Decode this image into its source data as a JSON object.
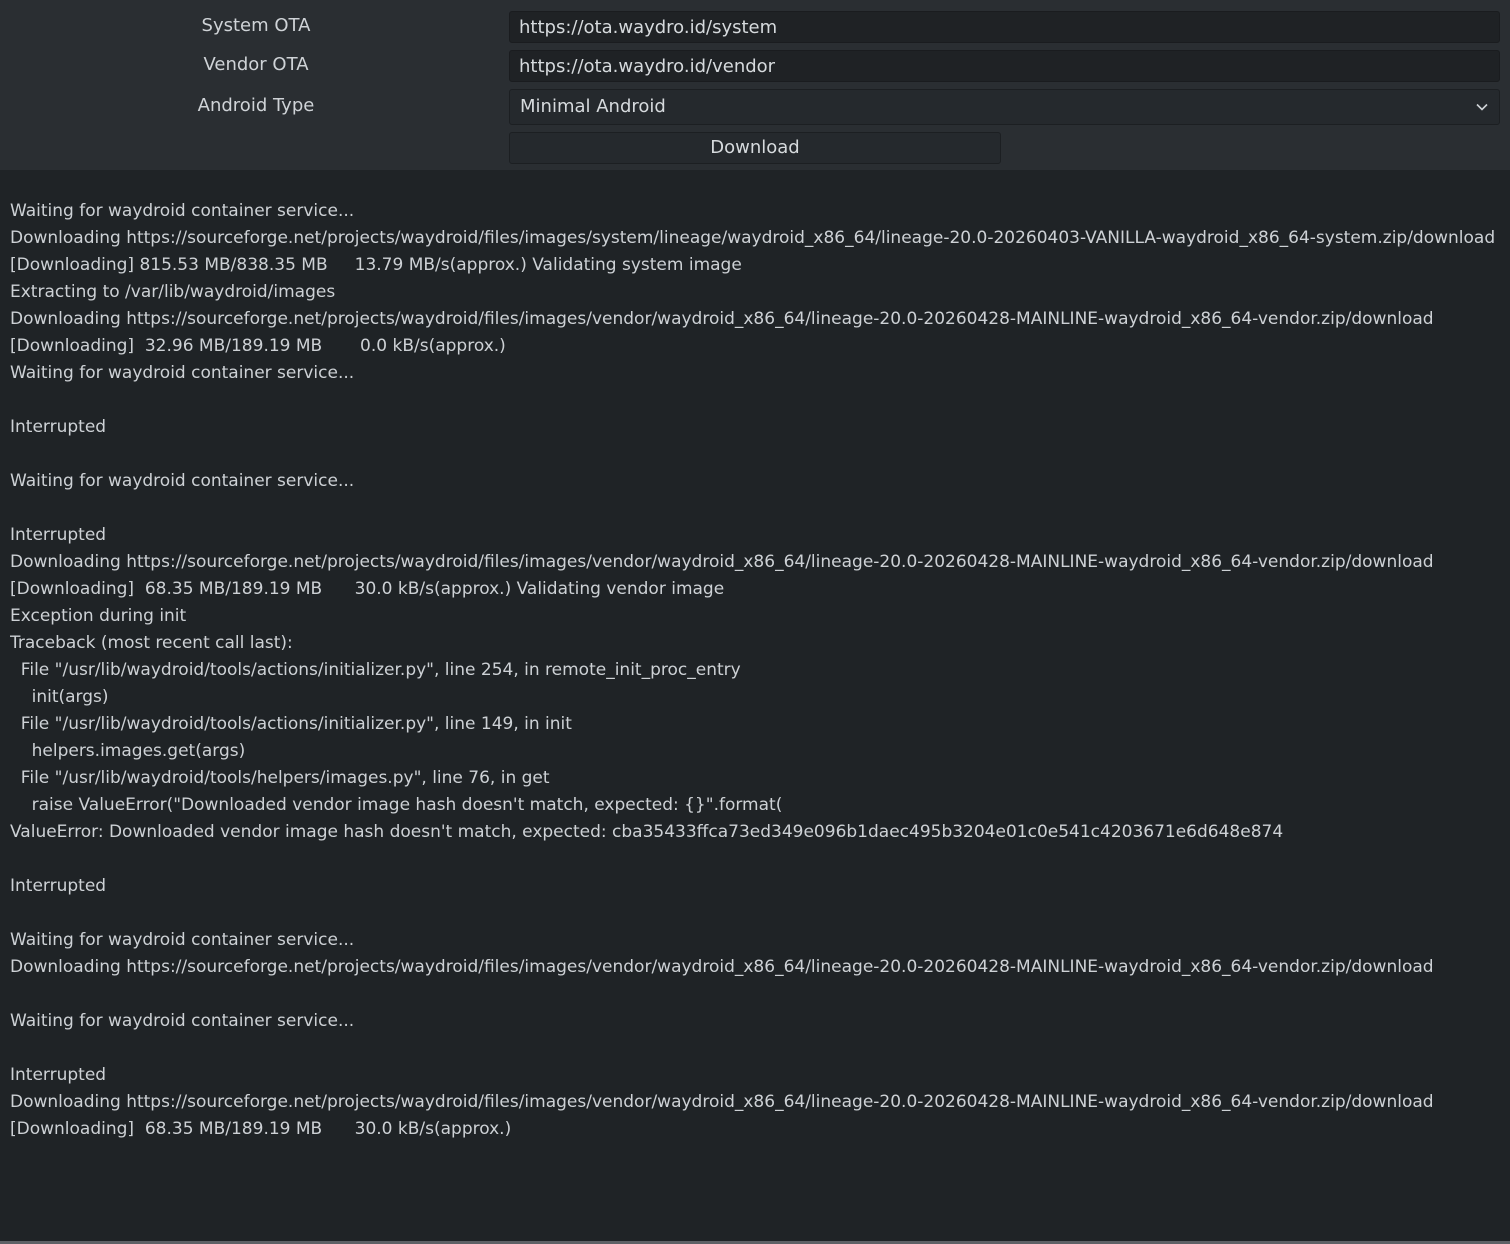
{
  "form": {
    "system_ota_label": "System OTA",
    "system_ota_value": "https://ota.waydro.id/system",
    "vendor_ota_label": "Vendor OTA",
    "vendor_ota_value": "https://ota.waydro.id/vendor",
    "android_type_label": "Android Type",
    "android_type_selected": "Minimal Android",
    "download_label": "Download"
  },
  "icons": {
    "dropdown": "chevron-down-icon"
  },
  "colors": {
    "background": "#2a2e32",
    "log_background": "#1f2326",
    "field_background": "#1f2225",
    "text": "#cfd3d7"
  },
  "log": {
    "lines": [
      "Waiting for waydroid container service...",
      "Downloading https://sourceforge.net/projects/waydroid/files/images/system/lineage/waydroid_x86_64/lineage-20.0-20260403-VANILLA-waydroid_x86_64-system.zip/download",
      "[Downloading] 815.53 MB/838.35 MB     13.79 MB/s(approx.) Validating system image",
      "Extracting to /var/lib/waydroid/images",
      "Downloading https://sourceforge.net/projects/waydroid/files/images/vendor/waydroid_x86_64/lineage-20.0-20260428-MAINLINE-waydroid_x86_64-vendor.zip/download",
      "[Downloading]  32.96 MB/189.19 MB       0.0 kB/s(approx.)",
      "Waiting for waydroid container service...",
      "",
      "Interrupted",
      "",
      "Waiting for waydroid container service...",
      "",
      "Interrupted",
      "Downloading https://sourceforge.net/projects/waydroid/files/images/vendor/waydroid_x86_64/lineage-20.0-20260428-MAINLINE-waydroid_x86_64-vendor.zip/download",
      "[Downloading]  68.35 MB/189.19 MB      30.0 kB/s(approx.) Validating vendor image",
      "Exception during init",
      "Traceback (most recent call last):",
      "  File \"/usr/lib/waydroid/tools/actions/initializer.py\", line 254, in remote_init_proc_entry",
      "    init(args)",
      "  File \"/usr/lib/waydroid/tools/actions/initializer.py\", line 149, in init",
      "    helpers.images.get(args)",
      "  File \"/usr/lib/waydroid/tools/helpers/images.py\", line 76, in get",
      "    raise ValueError(\"Downloaded vendor image hash doesn't match, expected: {}\".format(",
      "ValueError: Downloaded vendor image hash doesn't match, expected: cba35433ffca73ed349e096b1daec495b3204e01c0e541c4203671e6d648e874",
      "",
      "Interrupted",
      "",
      "Waiting for waydroid container service...",
      "Downloading https://sourceforge.net/projects/waydroid/files/images/vendor/waydroid_x86_64/lineage-20.0-20260428-MAINLINE-waydroid_x86_64-vendor.zip/download",
      "",
      "Waiting for waydroid container service...",
      "",
      "Interrupted",
      "Downloading https://sourceforge.net/projects/waydroid/files/images/vendor/waydroid_x86_64/lineage-20.0-20260428-MAINLINE-waydroid_x86_64-vendor.zip/download",
      "[Downloading]  68.35 MB/189.19 MB      30.0 kB/s(approx.)"
    ]
  }
}
